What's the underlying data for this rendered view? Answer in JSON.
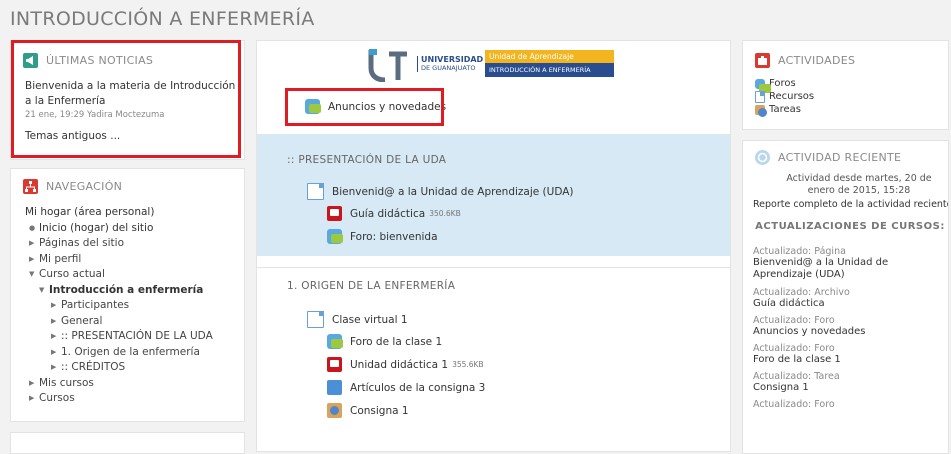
{
  "page": {
    "title": "INTRODUCCIÓN A ENFERMERÍA"
  },
  "news": {
    "heading": "ÚLTIMAS NOTICIAS",
    "post_title": "Bienvenida a la materia de Introducción a la Enfermería",
    "post_meta": "21 ene, 19:29  Yadira Moctezuma",
    "older": "Temas antiguos ..."
  },
  "nav": {
    "heading": "NAVEGACIÓN",
    "home": "Mi hogar (área personal)",
    "items": [
      "Inicio (hogar) del sitio",
      "Páginas del sitio",
      "Mi perfil",
      "Curso actual",
      "Introducción a enfermería",
      "Participantes",
      "General",
      ":: PRESENTACIÓN DE LA UDA",
      "1. Origen de la enfermería",
      ":: CRÉDITOS",
      "Mis cursos",
      "Cursos"
    ]
  },
  "banner": {
    "uni_line1": "UNIVERSIDAD",
    "uni_line2": "DE GUANAJUATO",
    "unit_line1": "Unidad de Aprendizaje",
    "unit_line2": "INTRODUCCIÓN A ENFERMERÍA"
  },
  "center": {
    "announcements": "Anuncios y novedades",
    "sec1": {
      "title": ":: PRESENTACIÓN DE LA UDA",
      "page": "Bienvenid@ a la Unidad de Aprendizaje (UDA)",
      "guide": "Guía didáctica",
      "guide_size": "350.6KB",
      "forum": "Foro: bienvenida"
    },
    "sec2": {
      "title": "1. ORIGEN DE LA ENFERMERÍA",
      "page": "Clase virtual 1",
      "forum": "Foro de la clase 1",
      "unit": "Unidad didáctica 1",
      "unit_size": "355.6KB",
      "folder": "Artículos de la consigna 3",
      "assign": "Consigna 1"
    }
  },
  "activities": {
    "heading": "ACTIVIDADES",
    "items": [
      "Foros",
      "Recursos",
      "Tareas"
    ]
  },
  "recent": {
    "heading": "ACTIVIDAD RECIENTE",
    "since": "Actividad desde martes, 20 de enero de 2015, 15:28",
    "report": "Reporte completo de la actividad reciente...",
    "updates_heading": "ACTUALIZACIONES DE CURSOS:",
    "updates": [
      {
        "label": "Actualizado: Página",
        "value": "Bienvenid@ a la Unidad de Aprendizaje (UDA)"
      },
      {
        "label": "Actualizado: Archivo",
        "value": "Guía didáctica"
      },
      {
        "label": "Actualizado: Foro",
        "value": "Anuncios y novedades"
      },
      {
        "label": "Actualizado: Foro",
        "value": "Foro de la clase 1"
      },
      {
        "label": "Actualizado: Tarea",
        "value": "Consigna 1"
      },
      {
        "label": "Actualizado: Foro"
      }
    ]
  },
  "colors": {
    "highlight_border": "#e01b22",
    "section_bg": "#d6e9f5",
    "news_icon": "#2e9e8a",
    "nav_icon": "#d9392f",
    "banner_gold": "#f2b51f",
    "banner_blue": "#2a4d8f"
  }
}
